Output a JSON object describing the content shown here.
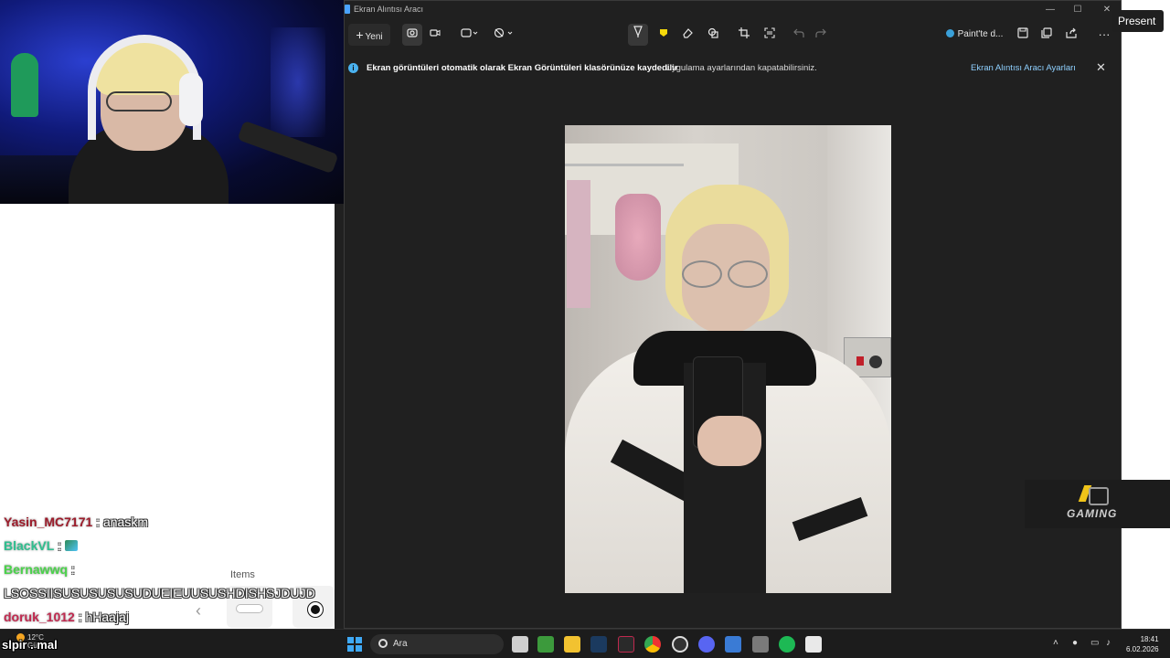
{
  "window": {
    "title": "Ekran Alıntısı Aracı",
    "min": "—",
    "max": "☐",
    "close": "✕"
  },
  "toolbar": {
    "new_label": "Yeni",
    "paint_label": "Paint'te d...",
    "more": "···"
  },
  "infobar": {
    "icon": "i",
    "message_bold": "Ekran görüntüleri otomatik olarak Ekran Görüntüleri klasörünüze kaydedilir",
    "message": "Uygulama ayarlarından kapatabilirsiniz.",
    "link": "Ekran Alıntısı Aracı Ayarları",
    "close": "✕"
  },
  "chat": {
    "messages": [
      {
        "user": "Yasin_MC7171",
        "sep": " : ",
        "text": "anaskm",
        "color": "#9c1b2a"
      },
      {
        "user": "BlackVL",
        "sep": " : ",
        "text": "",
        "color": "#2fbf8f",
        "emote": true
      },
      {
        "user": "Bernawwq",
        "sep": " :",
        "text": "",
        "color": "#4ad34a"
      },
      {
        "user": "",
        "sep": "",
        "text": "LSOSSIISUSUSUSUSUDUEIEUUSUSHDISHSJDUJD",
        "color": "#ffffff"
      },
      {
        "user": "doruk_1012",
        "sep": " : ",
        "text": "hHaajaj",
        "color": "#c0294f"
      }
    ],
    "items_label": "Items",
    "prev": "‹"
  },
  "overlay": {
    "present": "Present",
    "gaming": "GAMING"
  },
  "taskbar": {
    "slpir_mal": "slpir . mal",
    "weather_temp": "12°C",
    "weather_desc": "Güneşli",
    "search_placeholder": "Ara",
    "time": "18:41",
    "date": "6.02.2026"
  },
  "colors": {
    "accent": "#4ab2f0",
    "link": "#8fd0ff"
  }
}
